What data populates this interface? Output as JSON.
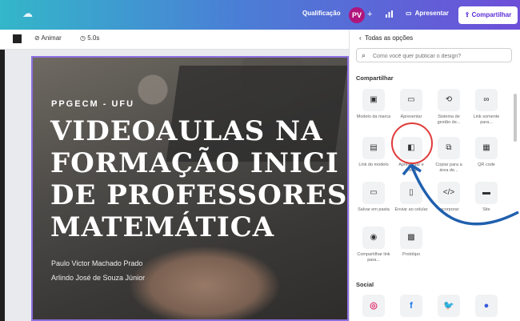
{
  "topbar": {
    "cloud_icon": "cloud-icon",
    "qualificacao": "Qualificação",
    "avatar_initials": "PV",
    "plus": "+",
    "present_label": "Apresentar",
    "share_label": "Compartilhar",
    "gradient": [
      "#33b7c9",
      "#4a7fd6",
      "#6d4fd8"
    ]
  },
  "toolbar": {
    "animate_label": "Animar",
    "duration_label": "5.0s"
  },
  "slide": {
    "tag": "PPGECM - UFU",
    "title_lines": [
      "VIDEOAULAS NA",
      "FORMAÇÃO INICI",
      "DE PROFESSORES",
      "MATEMÁTICA"
    ],
    "authors": [
      "Paulo Victor Machado Prado",
      "Arlindo José de Souza Júnior"
    ]
  },
  "panel": {
    "back_label": "Todas as opções",
    "search_placeholder": "Como você quer publicar o design?",
    "section_share": "Compartilhar",
    "section_social": "Social",
    "share_items": [
      {
        "icon": "template-icon",
        "label": "Modelo da marca"
      },
      {
        "icon": "present-icon",
        "label": "Apresentar"
      },
      {
        "icon": "manage-icon",
        "label": "Sistema de gestão de..."
      },
      {
        "icon": "link-icon",
        "label": "Link somente para..."
      },
      {
        "icon": "template-link-icon",
        "label": "Link do modelo"
      },
      {
        "icon": "record-icon",
        "label": "Apresentar e gravar"
      },
      {
        "icon": "copy-icon",
        "label": "Copiar para a área de..."
      },
      {
        "icon": "qr-icon",
        "label": "QR code"
      },
      {
        "icon": "folder-icon",
        "label": "Salvar em pasta"
      },
      {
        "icon": "phone-icon",
        "label": "Enviar ao celular"
      },
      {
        "icon": "embed-icon",
        "label": "Incorporar"
      },
      {
        "icon": "site-icon",
        "label": "Site"
      },
      {
        "icon": "view-icon",
        "label": "Compartilhar link para..."
      },
      {
        "icon": "prototype-icon",
        "label": "Protótipo"
      }
    ],
    "social_items": [
      {
        "icon": "instagram-icon",
        "color": "#e1306c"
      },
      {
        "icon": "facebook-icon",
        "color": "#1877f2"
      },
      {
        "icon": "twitter-icon",
        "color": "#1da1f2"
      },
      {
        "icon": "other-icon",
        "color": "#3b5bdb"
      }
    ]
  },
  "annotation": {
    "circle_color": "#e03a3a",
    "arrow_color": "#1f5fae"
  }
}
